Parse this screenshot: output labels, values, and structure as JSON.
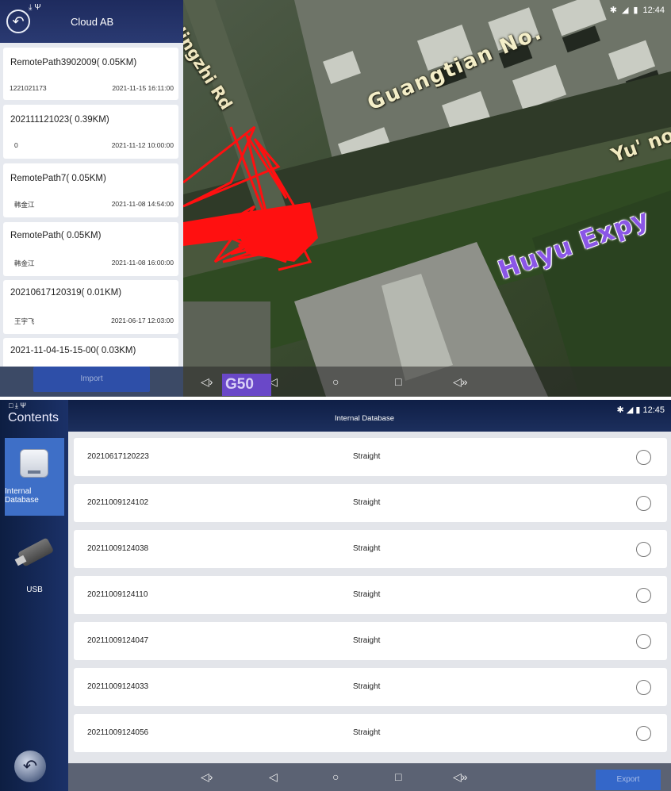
{
  "top": {
    "header_title": "Cloud AB",
    "status_time": "12:44",
    "paths": [
      {
        "name": "RemotePath3902009( 0.05KM)",
        "sub": "1221021173",
        "date": "2021-11-15 16:11:00"
      },
      {
        "name": "202111121023( 0.39KM)",
        "sub": "0",
        "date": "2021-11-12 10:00:00"
      },
      {
        "name": "RemotePath7( 0.05KM)",
        "sub": "韩金江",
        "date": "2021-11-08 14:54:00"
      },
      {
        "name": "RemotePath( 0.05KM)",
        "sub": "韩金江",
        "date": "2021-11-08 16:00:00"
      },
      {
        "name": "20210617120319( 0.01KM)",
        "sub": "王宇飞",
        "date": "2021-06-17 12:03:00"
      },
      {
        "name": "2021-11-04-15-15-00( 0.03KM)",
        "sub": "",
        "date": ""
      }
    ],
    "import_label": "Import",
    "map_labels": {
      "guangtian": "Guangtian No.",
      "jingzhi": "Jingzhi Rd",
      "yuno": "Yu' no",
      "huyu": "Huyu Expy",
      "g50": "G50"
    },
    "icons": [
      "back-arrow-icon",
      "download-icon",
      "usb-icon",
      "bluetooth-icon",
      "signal-icon",
      "battery-icon"
    ]
  },
  "bottom": {
    "sidebar_title": "Contents",
    "header_title": "Internal Database",
    "status_time": "12:45",
    "nav": [
      {
        "label": "Internal Database",
        "icon": "hard-drive-icon",
        "selected": true
      },
      {
        "label": "USB",
        "icon": "usb-stick-icon",
        "selected": false
      }
    ],
    "rows": [
      {
        "id": "20210617120223",
        "type": "Straight"
      },
      {
        "id": "20211009124102",
        "type": "Straight"
      },
      {
        "id": "20211009124038",
        "type": "Straight"
      },
      {
        "id": "20211009124110",
        "type": "Straight"
      },
      {
        "id": "20211009124047",
        "type": "Straight"
      },
      {
        "id": "20211009124033",
        "type": "Straight"
      },
      {
        "id": "20211009124056",
        "type": "Straight"
      }
    ],
    "export_label": "Export"
  },
  "colors": {
    "header_navy": "#1e2b5e",
    "selected_blue": "#3e6fc7",
    "button_blue": "#3467c9",
    "path_red": "#ff1010",
    "expressway_purple": "#8a56e6"
  }
}
